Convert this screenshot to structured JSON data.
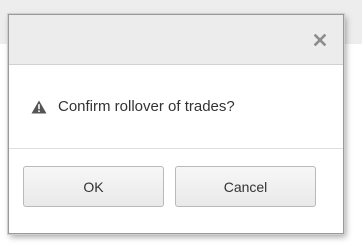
{
  "dialog": {
    "close_icon": "close-icon",
    "warning_icon": "warning-triangle-icon",
    "message": "Confirm rollover of trades?",
    "buttons": {
      "ok_label": "OK",
      "cancel_label": "Cancel"
    }
  },
  "colors": {
    "titlebar": "#ececec",
    "dialog_background": "#ffffff",
    "text": "#333333",
    "icon": "#5c5c5c"
  }
}
